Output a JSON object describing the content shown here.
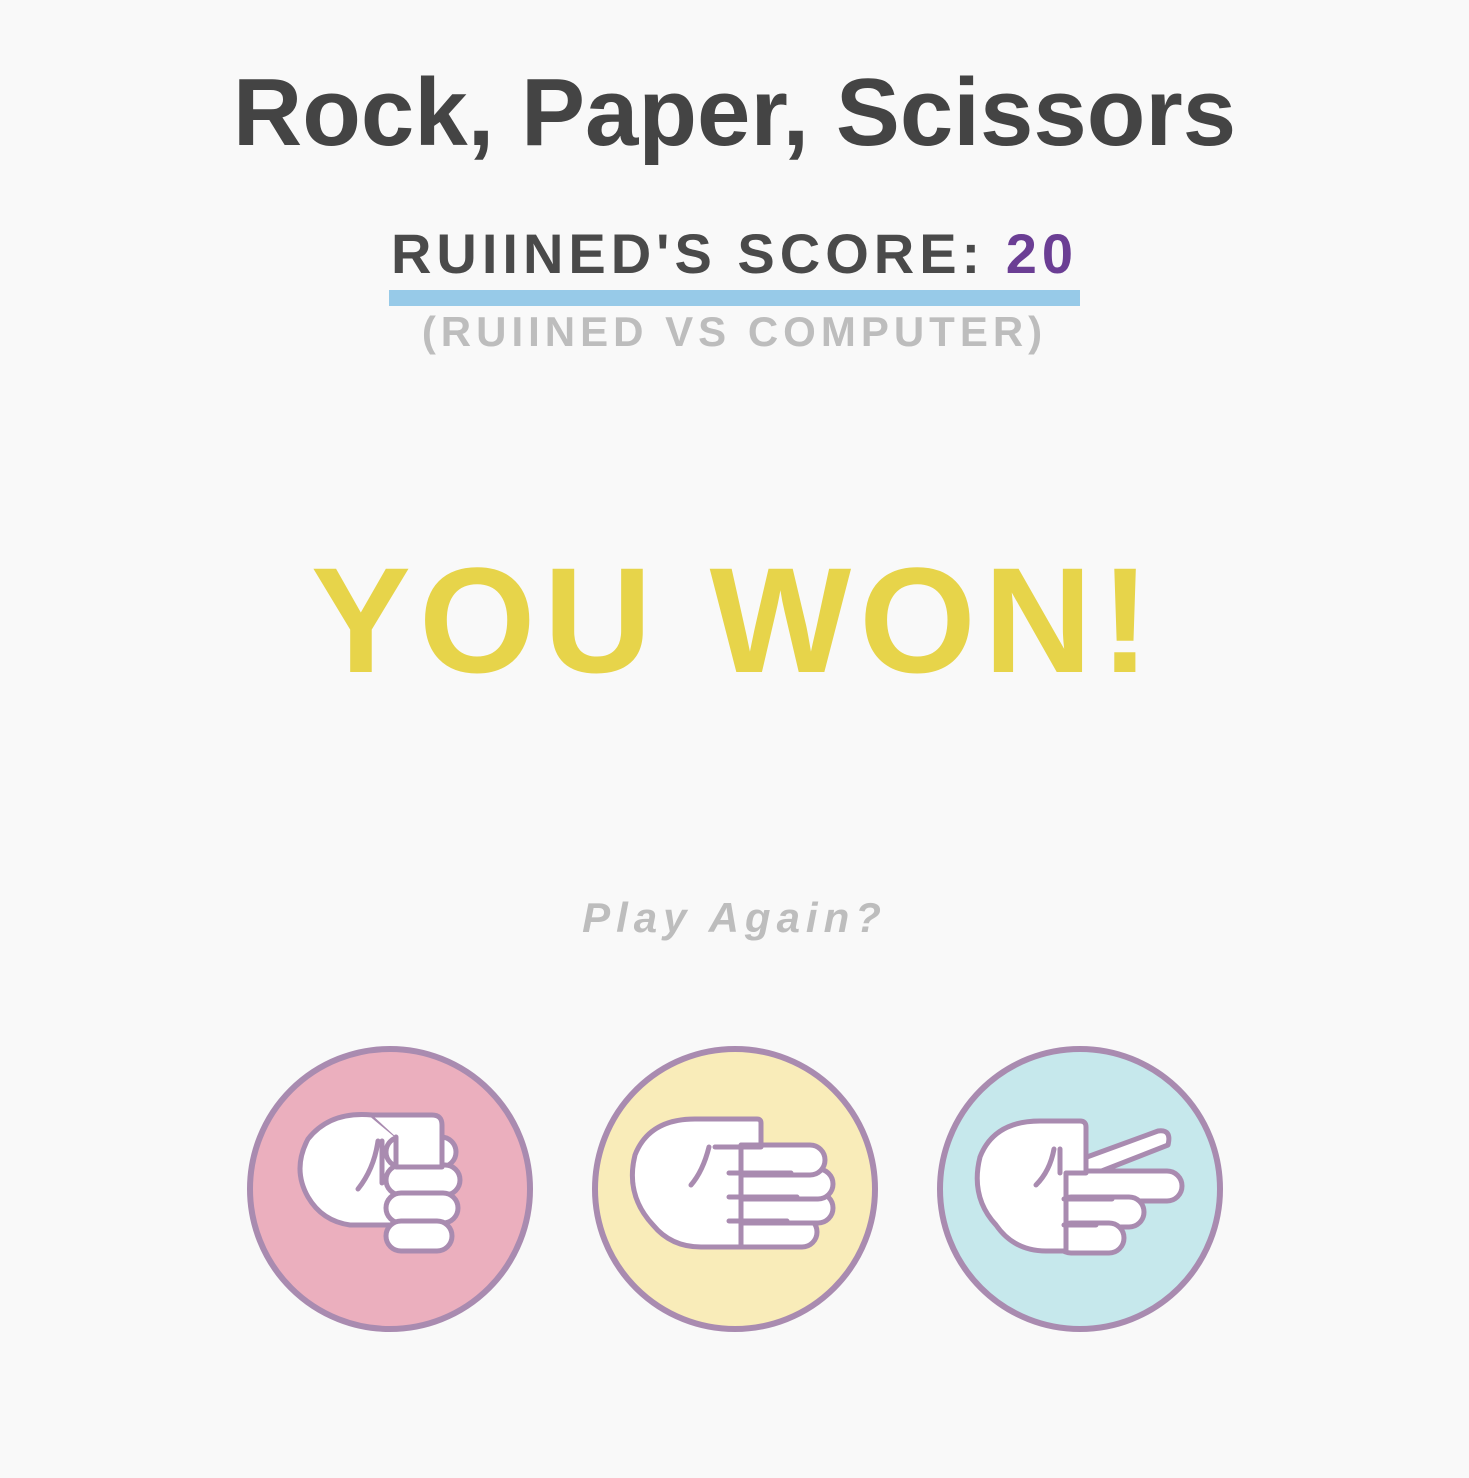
{
  "header": {
    "title": "Rock, Paper, Scissors"
  },
  "score": {
    "label": "RUIINED'S SCORE:",
    "value": "20",
    "matchup": "(RUIINED VS COMPUTER)"
  },
  "result": {
    "text": "YOU WON!"
  },
  "actions": {
    "play_again": "Play Again?"
  },
  "choices": [
    {
      "name": "rock",
      "icon": "rock-hand-icon",
      "bg": "#ebafbe"
    },
    {
      "name": "paper",
      "icon": "paper-hand-icon",
      "bg": "#f9ecb9"
    },
    {
      "name": "scissors",
      "icon": "scissors-hand-icon",
      "bg": "#c6e8ec"
    }
  ],
  "colors": {
    "background": "#f9f9f9",
    "title": "#444444",
    "score_value": "#6b3e94",
    "underline": "#97cae8",
    "result": "#e7d44a",
    "muted": "#bdbdbd",
    "outline": "#a98bb0"
  }
}
